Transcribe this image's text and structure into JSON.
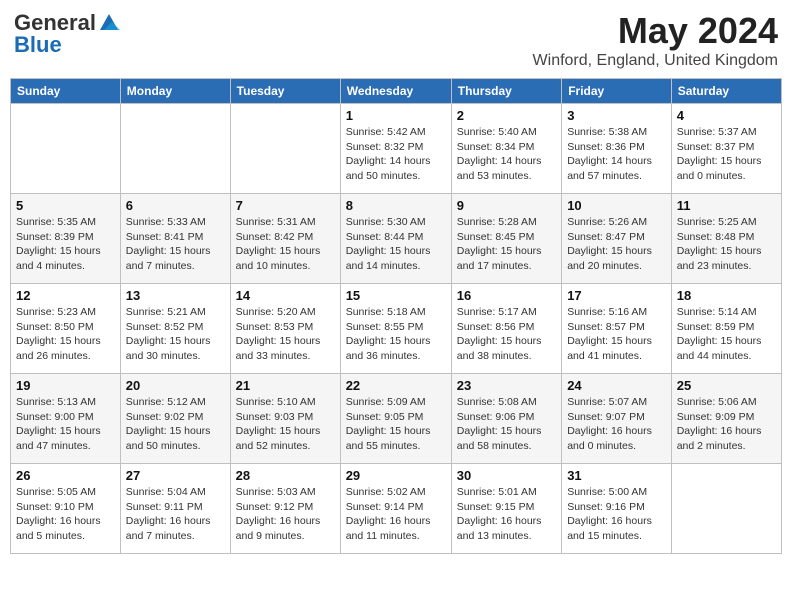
{
  "header": {
    "logo_general": "General",
    "logo_blue": "Blue",
    "month_year": "May 2024",
    "location": "Winford, England, United Kingdom"
  },
  "days_of_week": [
    "Sunday",
    "Monday",
    "Tuesday",
    "Wednesday",
    "Thursday",
    "Friday",
    "Saturday"
  ],
  "weeks": [
    [
      {
        "day": "",
        "info": ""
      },
      {
        "day": "",
        "info": ""
      },
      {
        "day": "",
        "info": ""
      },
      {
        "day": "1",
        "info": "Sunrise: 5:42 AM\nSunset: 8:32 PM\nDaylight: 14 hours and 50 minutes."
      },
      {
        "day": "2",
        "info": "Sunrise: 5:40 AM\nSunset: 8:34 PM\nDaylight: 14 hours and 53 minutes."
      },
      {
        "day": "3",
        "info": "Sunrise: 5:38 AM\nSunset: 8:36 PM\nDaylight: 14 hours and 57 minutes."
      },
      {
        "day": "4",
        "info": "Sunrise: 5:37 AM\nSunset: 8:37 PM\nDaylight: 15 hours and 0 minutes."
      }
    ],
    [
      {
        "day": "5",
        "info": "Sunrise: 5:35 AM\nSunset: 8:39 PM\nDaylight: 15 hours and 4 minutes."
      },
      {
        "day": "6",
        "info": "Sunrise: 5:33 AM\nSunset: 8:41 PM\nDaylight: 15 hours and 7 minutes."
      },
      {
        "day": "7",
        "info": "Sunrise: 5:31 AM\nSunset: 8:42 PM\nDaylight: 15 hours and 10 minutes."
      },
      {
        "day": "8",
        "info": "Sunrise: 5:30 AM\nSunset: 8:44 PM\nDaylight: 15 hours and 14 minutes."
      },
      {
        "day": "9",
        "info": "Sunrise: 5:28 AM\nSunset: 8:45 PM\nDaylight: 15 hours and 17 minutes."
      },
      {
        "day": "10",
        "info": "Sunrise: 5:26 AM\nSunset: 8:47 PM\nDaylight: 15 hours and 20 minutes."
      },
      {
        "day": "11",
        "info": "Sunrise: 5:25 AM\nSunset: 8:48 PM\nDaylight: 15 hours and 23 minutes."
      }
    ],
    [
      {
        "day": "12",
        "info": "Sunrise: 5:23 AM\nSunset: 8:50 PM\nDaylight: 15 hours and 26 minutes."
      },
      {
        "day": "13",
        "info": "Sunrise: 5:21 AM\nSunset: 8:52 PM\nDaylight: 15 hours and 30 minutes."
      },
      {
        "day": "14",
        "info": "Sunrise: 5:20 AM\nSunset: 8:53 PM\nDaylight: 15 hours and 33 minutes."
      },
      {
        "day": "15",
        "info": "Sunrise: 5:18 AM\nSunset: 8:55 PM\nDaylight: 15 hours and 36 minutes."
      },
      {
        "day": "16",
        "info": "Sunrise: 5:17 AM\nSunset: 8:56 PM\nDaylight: 15 hours and 38 minutes."
      },
      {
        "day": "17",
        "info": "Sunrise: 5:16 AM\nSunset: 8:57 PM\nDaylight: 15 hours and 41 minutes."
      },
      {
        "day": "18",
        "info": "Sunrise: 5:14 AM\nSunset: 8:59 PM\nDaylight: 15 hours and 44 minutes."
      }
    ],
    [
      {
        "day": "19",
        "info": "Sunrise: 5:13 AM\nSunset: 9:00 PM\nDaylight: 15 hours and 47 minutes."
      },
      {
        "day": "20",
        "info": "Sunrise: 5:12 AM\nSunset: 9:02 PM\nDaylight: 15 hours and 50 minutes."
      },
      {
        "day": "21",
        "info": "Sunrise: 5:10 AM\nSunset: 9:03 PM\nDaylight: 15 hours and 52 minutes."
      },
      {
        "day": "22",
        "info": "Sunrise: 5:09 AM\nSunset: 9:05 PM\nDaylight: 15 hours and 55 minutes."
      },
      {
        "day": "23",
        "info": "Sunrise: 5:08 AM\nSunset: 9:06 PM\nDaylight: 15 hours and 58 minutes."
      },
      {
        "day": "24",
        "info": "Sunrise: 5:07 AM\nSunset: 9:07 PM\nDaylight: 16 hours and 0 minutes."
      },
      {
        "day": "25",
        "info": "Sunrise: 5:06 AM\nSunset: 9:09 PM\nDaylight: 16 hours and 2 minutes."
      }
    ],
    [
      {
        "day": "26",
        "info": "Sunrise: 5:05 AM\nSunset: 9:10 PM\nDaylight: 16 hours and 5 minutes."
      },
      {
        "day": "27",
        "info": "Sunrise: 5:04 AM\nSunset: 9:11 PM\nDaylight: 16 hours and 7 minutes."
      },
      {
        "day": "28",
        "info": "Sunrise: 5:03 AM\nSunset: 9:12 PM\nDaylight: 16 hours and 9 minutes."
      },
      {
        "day": "29",
        "info": "Sunrise: 5:02 AM\nSunset: 9:14 PM\nDaylight: 16 hours and 11 minutes."
      },
      {
        "day": "30",
        "info": "Sunrise: 5:01 AM\nSunset: 9:15 PM\nDaylight: 16 hours and 13 minutes."
      },
      {
        "day": "31",
        "info": "Sunrise: 5:00 AM\nSunset: 9:16 PM\nDaylight: 16 hours and 15 minutes."
      },
      {
        "day": "",
        "info": ""
      }
    ]
  ]
}
